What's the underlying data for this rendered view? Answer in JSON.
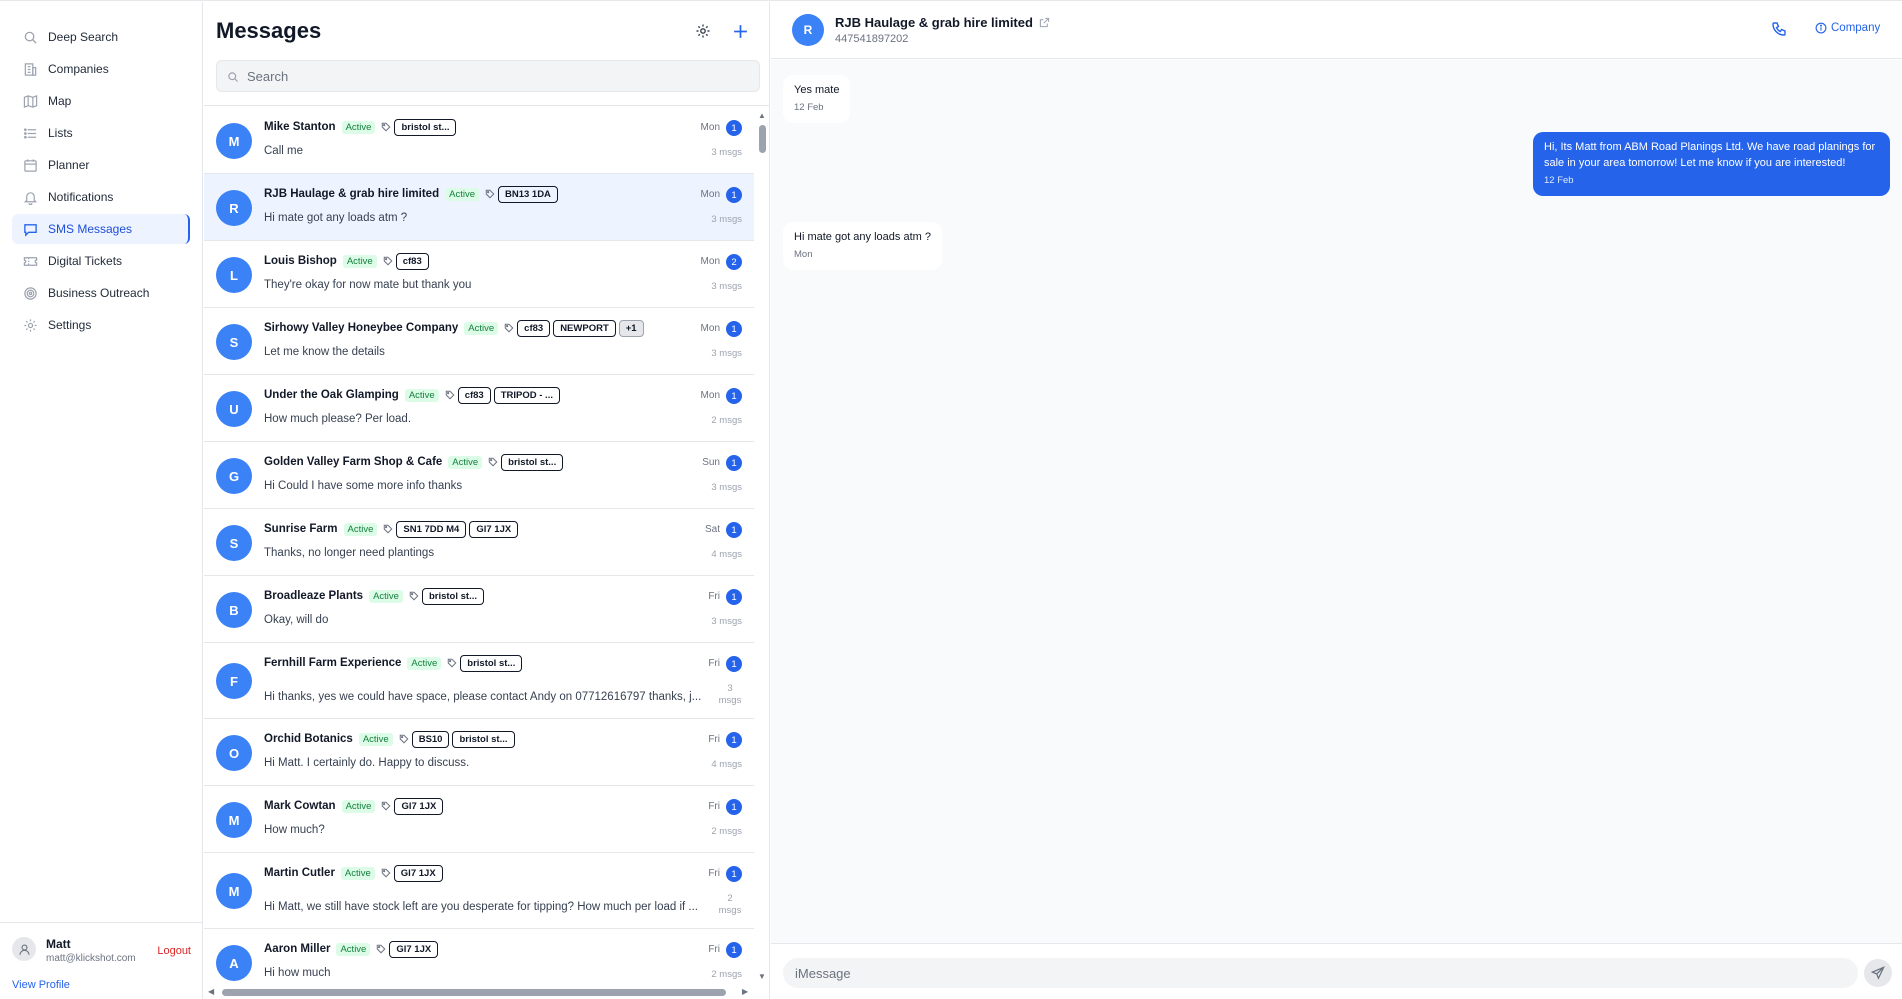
{
  "sidebar": {
    "items": [
      {
        "label": "Deep Search",
        "icon": "search-icon"
      },
      {
        "label": "Companies",
        "icon": "building-icon"
      },
      {
        "label": "Map",
        "icon": "map-icon"
      },
      {
        "label": "Lists",
        "icon": "list-icon"
      },
      {
        "label": "Planner",
        "icon": "calendar-icon"
      },
      {
        "label": "Notifications",
        "icon": "bell-icon"
      },
      {
        "label": "SMS Messages",
        "icon": "message-icon",
        "active": true
      },
      {
        "label": "Digital Tickets",
        "icon": "ticket-icon"
      },
      {
        "label": "Business Outreach",
        "icon": "target-icon"
      },
      {
        "label": "Settings",
        "icon": "gear-icon"
      }
    ],
    "user": {
      "name": "Matt",
      "email": "matt@klickshot.com",
      "logout_label": "Logout",
      "view_profile_label": "View Profile"
    }
  },
  "messages_panel": {
    "title": "Messages",
    "search_placeholder": "Search",
    "conversations": [
      {
        "initial": "M",
        "name": "Mike Stanton",
        "status": "Active",
        "tags": [
          "bristol st..."
        ],
        "preview": "Call me",
        "day": "Mon",
        "unread": "1",
        "count": "3 msgs"
      },
      {
        "initial": "R",
        "name": "RJB Haulage & grab hire limited",
        "status": "Active",
        "tags": [
          "BN13 1DA"
        ],
        "preview": "Hi mate got any loads atm ?",
        "day": "Mon",
        "unread": "1",
        "count": "3 msgs",
        "selected": true
      },
      {
        "initial": "L",
        "name": "Louis Bishop",
        "status": "Active",
        "tags": [
          "cf83"
        ],
        "preview": "They're okay for now mate but thank you",
        "day": "Mon",
        "unread": "2",
        "count": "3 msgs"
      },
      {
        "initial": "S",
        "name": "Sirhowy Valley Honeybee Company",
        "status": "Active",
        "tags": [
          "cf83",
          "NEWPORT"
        ],
        "more_tag": "+1",
        "preview": "Let me know the details",
        "day": "Mon",
        "unread": "1",
        "count": "3 msgs"
      },
      {
        "initial": "U",
        "name": "Under the Oak Glamping",
        "status": "Active",
        "tags": [
          "cf83",
          "TRIPOD - ..."
        ],
        "preview": "How much please? Per load.",
        "day": "Mon",
        "unread": "1",
        "count": "2 msgs"
      },
      {
        "initial": "G",
        "name": "Golden Valley Farm Shop & Cafe",
        "status": "Active",
        "tags": [
          "bristol st..."
        ],
        "preview": "Hi Could I have some more info thanks",
        "day": "Sun",
        "unread": "1",
        "count": "3 msgs"
      },
      {
        "initial": "S",
        "name": "Sunrise Farm",
        "status": "Active",
        "tags": [
          "SN1 7DD M4",
          "Gl7 1JX"
        ],
        "preview": "Thanks, no longer need plantings",
        "day": "Sat",
        "unread": "1",
        "count": "4 msgs"
      },
      {
        "initial": "B",
        "name": "Broadleaze Plants",
        "status": "Active",
        "tags": [
          "bristol st..."
        ],
        "preview": "Okay, will do",
        "day": "Fri",
        "unread": "1",
        "count": "3 msgs"
      },
      {
        "initial": "F",
        "name": "Fernhill Farm Experience",
        "status": "Active",
        "tags": [
          "bristol st..."
        ],
        "preview": "Hi thanks, yes we could have space, please contact Andy on 07712616797 thanks, j...",
        "day": "Fri",
        "unread": "1",
        "count": "3 msgs",
        "tall": true
      },
      {
        "initial": "O",
        "name": "Orchid Botanics",
        "status": "Active",
        "tags": [
          "BS10",
          "bristol st..."
        ],
        "preview": "Hi Matt. I certainly do. Happy to discuss.",
        "day": "Fri",
        "unread": "1",
        "count": "4 msgs"
      },
      {
        "initial": "M",
        "name": "Mark Cowtan",
        "status": "Active",
        "tags": [
          "Gl7 1JX"
        ],
        "preview": "How much?",
        "day": "Fri",
        "unread": "1",
        "count": "2 msgs"
      },
      {
        "initial": "M",
        "name": "Martin Cutler",
        "status": "Active",
        "tags": [
          "Gl7 1JX"
        ],
        "preview": "Hi Matt, we still have stock left are you desperate for tipping? How much per load if ...",
        "day": "Fri",
        "unread": "1",
        "count": "2 msgs",
        "tall": true
      },
      {
        "initial": "A",
        "name": "Aaron Miller",
        "status": "Active",
        "tags": [
          "Gl7 1JX"
        ],
        "preview": "Hi how much",
        "day": "Fri",
        "unread": "1",
        "count": "2 msgs"
      }
    ]
  },
  "chat": {
    "initial": "R",
    "name": "RJB Haulage & grab hire limited",
    "phone": "447541897202",
    "company_label": "Company",
    "messages": [
      {
        "direction": "in",
        "text": "Yes mate",
        "time": "12 Feb"
      },
      {
        "direction": "out",
        "text": "Hi, Its Matt from ABM Road Planings Ltd. We have road planings for sale in your area tomorrow! Let me know if you are interested!",
        "time": "12 Feb"
      },
      {
        "direction": "in",
        "text": "Hi mate got any loads atm ?",
        "time": "Mon"
      }
    ],
    "composer_placeholder": "iMessage"
  },
  "colors": {
    "accent": "#2563eb",
    "avatar": "#3b82f6",
    "active_badge_bg": "#dcfce7",
    "active_badge_text": "#15803d",
    "logout": "#dc2626"
  }
}
